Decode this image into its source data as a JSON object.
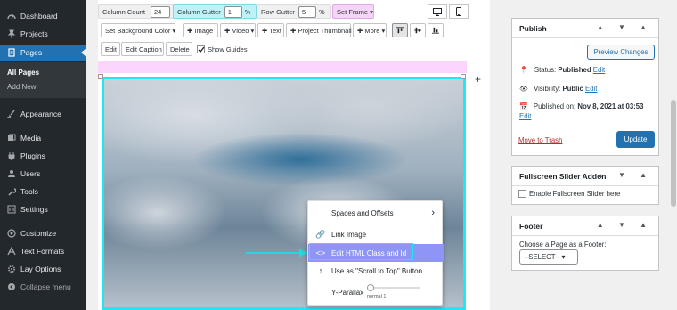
{
  "sidebar": {
    "items": [
      {
        "label": "Dashboard",
        "icon": "dashboard-icon"
      },
      {
        "label": "Projects",
        "icon": "pin-icon"
      },
      {
        "label": "Pages",
        "icon": "pages-icon"
      },
      {
        "label": "Appearance",
        "icon": "brush-icon"
      },
      {
        "label": "Media",
        "icon": "media-icon"
      },
      {
        "label": "Plugins",
        "icon": "plugin-icon"
      },
      {
        "label": "Users",
        "icon": "user-icon"
      },
      {
        "label": "Tools",
        "icon": "wrench-icon"
      },
      {
        "label": "Settings",
        "icon": "settings-icon"
      },
      {
        "label": "Customize",
        "icon": "customize-icon"
      },
      {
        "label": "Text Formats",
        "icon": "text-icon"
      },
      {
        "label": "Lay Options",
        "icon": "gear-icon"
      },
      {
        "label": "Collapse menu",
        "icon": "collapse-icon"
      }
    ],
    "submenu": {
      "all_pages": "All Pages",
      "add_new": "Add New"
    }
  },
  "toolbar": {
    "column_count_label": "Column Count",
    "column_count_value": "24",
    "column_gutter_label": "Column Gutter",
    "column_gutter_value": "1",
    "percent": "%",
    "row_gutter_label": "Row Gutter",
    "row_gutter_value": "5",
    "set_frame": "Set Frame ▾",
    "set_bg": "Set Background Color ▾",
    "image": "✚ Image",
    "video": "✚ Video ▾",
    "text": "✚ Text",
    "project_thumb": "✚ Project Thumbnail",
    "more": "✚ More ▾",
    "edit": "Edit",
    "edit_caption": "Edit Caption",
    "delete": "Delete",
    "show_guides": "Show Guides",
    "more_dots": "···"
  },
  "context_menu": {
    "spaces": "Spaces and Offsets",
    "link_image": "Link Image",
    "edit_html": "Edit HTML Class and Id",
    "scroll_top": "Use as \"Scroll to Top\" Button",
    "yparallax": "Y-Parallax",
    "normal": "normal 1"
  },
  "publish": {
    "title": "Publish",
    "preview": "Preview Changes",
    "status_label": "Status:",
    "status_value": "Published",
    "status_edit": "Edit",
    "visibility_label": "Visibility:",
    "visibility_value": "Public",
    "visibility_edit": "Edit",
    "published_on": "Published on:",
    "published_date": "Nov 8, 2021 at 03:53",
    "date_edit": "Edit",
    "trash": "Move to Trash",
    "update": "Update"
  },
  "slider_addon": {
    "title": "Fullscreen Slider Addon",
    "checkbox_label": "Enable Fullscreen Slider here"
  },
  "footer_box": {
    "title": "Footer",
    "choose_label": "Choose a Page as a Footer:",
    "select_value": "--SELECT-- ▾"
  },
  "box_controls": "▲ ▼ ▲",
  "colors": {
    "accent": "#2271b1",
    "sidebar": "#23282d",
    "selection": "#20e8f0",
    "menu_highlight": "#8f95f5"
  }
}
